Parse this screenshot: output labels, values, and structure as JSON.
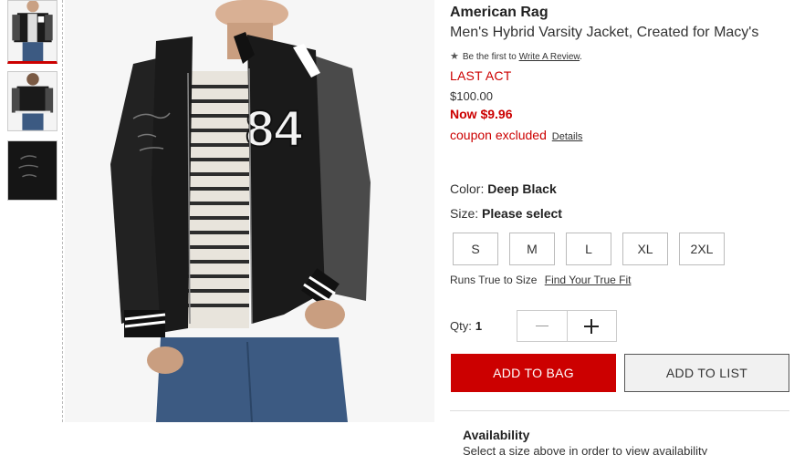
{
  "product": {
    "brand": "American Rag",
    "title": "Men's Hybrid Varsity Jacket, Created for Macy's",
    "jacket_number": "84"
  },
  "reviews": {
    "prefix": "Be the first to",
    "link": "Write A Review",
    "suffix": "."
  },
  "pricing": {
    "badge": "LAST ACT",
    "original": "$100.00",
    "now": "Now $9.96",
    "coupon_text": "coupon excluded",
    "coupon_link": "Details"
  },
  "color": {
    "label": "Color:",
    "value": "Deep Black"
  },
  "size": {
    "label": "Size:",
    "value": "Please select",
    "options": [
      "S",
      "M",
      "L",
      "XL",
      "2XL"
    ]
  },
  "fit": {
    "text": "Runs True to Size",
    "link": "Find Your True Fit"
  },
  "quantity": {
    "label": "Qty:",
    "value": "1"
  },
  "actions": {
    "add_to_bag": "ADD TO BAG",
    "add_to_list": "ADD TO LIST"
  },
  "availability": {
    "title": "Availability",
    "text": "Select a size above in order to view availability"
  },
  "colors": {
    "accent_red": "#cc0000",
    "jacket_body": "#1a1a1a",
    "jacket_sleeve": "#4a4a4a",
    "jeans": "#3c5a82"
  },
  "icons": {
    "star": "star-icon",
    "minus": "minus-icon",
    "plus": "plus-icon"
  }
}
